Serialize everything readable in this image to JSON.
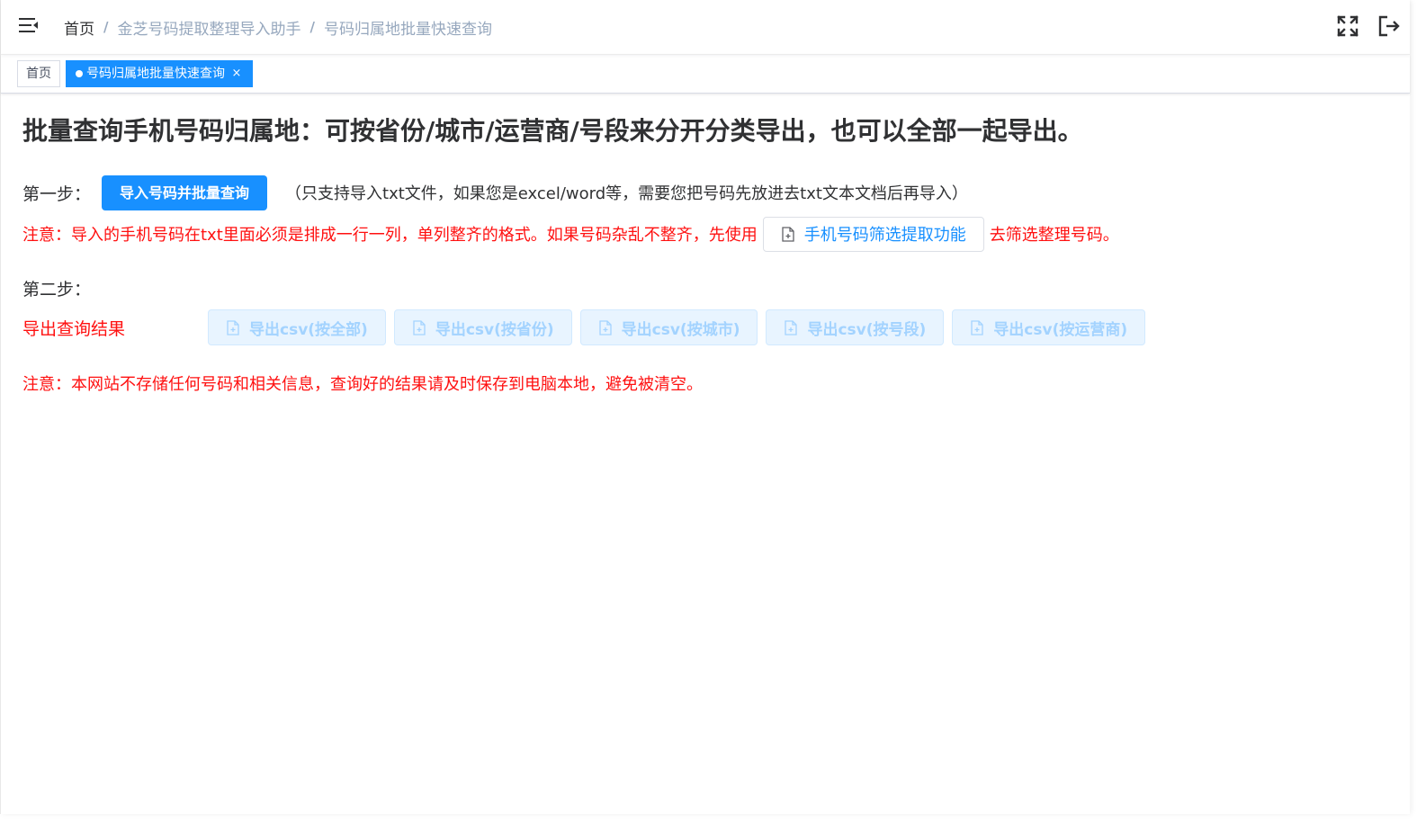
{
  "header": {
    "breadcrumb": {
      "home": "首页",
      "separator": "/",
      "parent": "金芝号码提取整理导入助手",
      "current": "号码归属地批量快速查询"
    },
    "icons": {
      "menu": "hamburger-fold-icon",
      "fullscreen": "fullscreen-icon",
      "logout": "logout-icon"
    }
  },
  "tags": {
    "home": "首页",
    "active": "号码归属地批量快速查询",
    "close": "×"
  },
  "main": {
    "title": "批量查询手机号码归属地：可按省份/城市/运营商/号段来分开分类导出，也可以全部一起导出。",
    "step1": {
      "label": "第一步：",
      "button": "导入号码并批量查询",
      "hint": "（只支持导入txt文件，如果您是excel/word等，需要您把号码先放进去txt文本文档后再导入）"
    },
    "note1": {
      "before": "注意：导入的手机号码在txt里面必须是排成一行一列，单列整齐的格式。如果号码杂乱不整齐，先使用",
      "button": "手机号码筛选提取功能",
      "after": "去筛选整理号码。"
    },
    "step2": {
      "label": "第二步："
    },
    "export": {
      "label": "导出查询结果",
      "buttons": [
        "导出csv(按全部)",
        "导出csv(按省份)",
        "导出csv(按城市)",
        "导出csv(按号段)",
        "导出csv(按运营商)"
      ]
    },
    "note2": "注意：本网站不存储任何号码和相关信息，查询好的结果请及时保存到电脑本地，避免被清空。"
  },
  "colors": {
    "primary": "#1890ff",
    "warning_red": "#ff1010",
    "disabled_bg": "#e8f4ff",
    "disabled_text": "#a3d3ff",
    "breadcrumb_link": "#97a8be"
  }
}
